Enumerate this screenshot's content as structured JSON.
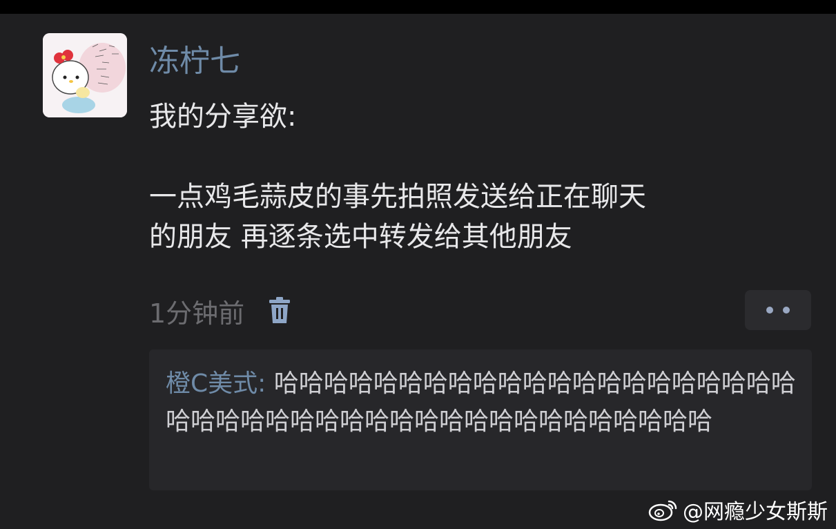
{
  "post": {
    "username": "冻柠七",
    "content_line1": "我的分享欲:",
    "content_line2": "一点鸡毛蒜皮的事先拍照发送给正在聊天",
    "content_line3": "的朋友 再逐条选中转发给其他朋友",
    "timestamp": "1分钟前",
    "avatar_icon": "hello-kitty-avatar-icon",
    "delete_icon": "trash-icon",
    "more_icon": "more-dots-icon"
  },
  "comment": {
    "author": "橙C美式:",
    "text": " 哈哈哈哈哈哈哈哈哈哈哈哈哈哈哈哈哈哈哈哈哈哈哈哈哈哈哈哈哈哈哈哈哈哈哈哈哈哈哈哈哈哈哈"
  },
  "watermark": {
    "text": "@网瘾少女斯斯",
    "icon": "weibo-logo-icon"
  },
  "colors": {
    "background": "#1f1f21",
    "username": "#6f8ba8",
    "content": "#e8e8ea",
    "timestamp": "#6c6c70",
    "comment_background": "#27272a"
  }
}
